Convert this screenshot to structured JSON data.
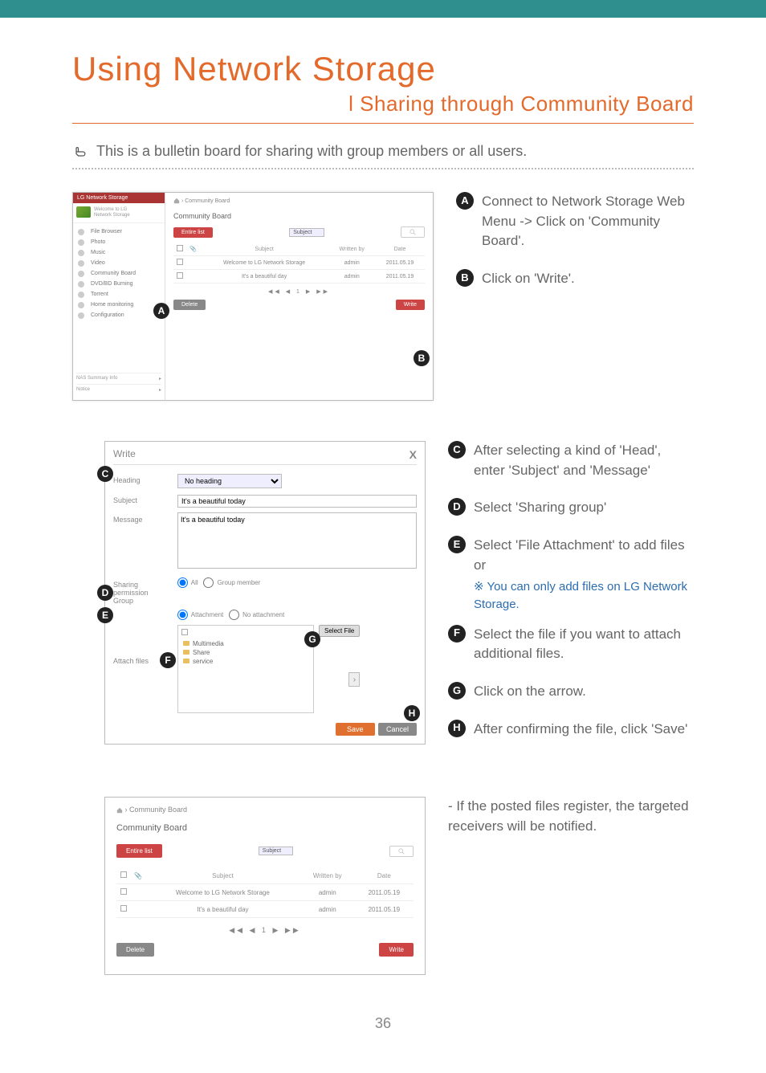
{
  "header": {
    "title": "Using Network Storage",
    "subtitle": "l Sharing through Community Board",
    "intro": "This is a bulletin board for sharing with group members or all users."
  },
  "page_number": "36",
  "shotA": {
    "brand": "LG Network Storage",
    "welcome_line1": "Welcome to LG",
    "welcome_line2": "Network Storage",
    "sidebar_items": [
      "File Browser",
      "Photo",
      "Music",
      "Video",
      "Community Board",
      "DVD/BD Burning",
      "Torrent",
      "Home monitoring",
      "Configuration"
    ],
    "footer1": "NAS Summary Info",
    "footer2": "Notice",
    "breadcrumb": "› Community Board",
    "panel_title": "Community Board",
    "entire_list": "Entire list",
    "subject_filter": "Subject",
    "columns": [
      "",
      "",
      "Subject",
      "Written by",
      "Date"
    ],
    "rows": [
      {
        "subject": "Welcome to LG Network Storage",
        "by": "admin",
        "date": "2011.05.19"
      },
      {
        "subject": "It's a beautiful day",
        "by": "admin",
        "date": "2011.05.19"
      }
    ],
    "pager": "◀◀ ◀ 1 ▶ ▶▶",
    "delete": "Delete",
    "write": "Write"
  },
  "calloutsA": {
    "A": "Connect to Network Storage Web Menu -> Click on 'Community Board'.",
    "B": "Click on 'Write'."
  },
  "shotB": {
    "dialog_title": "Write",
    "close": "X",
    "heading_label": "Heading",
    "heading_value": "No heading",
    "subject_label": "Subject",
    "subject_value": "It's a beautiful today",
    "message_label": "Message",
    "message_value": "It's a beautiful today",
    "sharing_label_1": "Sharing",
    "sharing_label_2": "permission",
    "sharing_label_3": "Group",
    "radio_all": "All",
    "radio_group": "Group member",
    "attach_radio_attach": "Attachment",
    "attach_radio_none": "No attachment",
    "attach_label": "Attach files",
    "tree_items": [
      "Multimedia",
      "Share",
      "service"
    ],
    "select_file": "Select File",
    "save": "Save",
    "cancel": "Cancel"
  },
  "calloutsB": {
    "C": "After selecting a kind of 'Head', enter 'Subject' and 'Message'",
    "D": "Select 'Sharing group'",
    "E": "Select 'File Attachment' to add files or",
    "E_note": "※ You can only add files on LG Network Storage.",
    "F": "Select the file if you want to attach additional files.",
    "G": "Click on the arrow.",
    "H": "After confirming the file, click 'Save'"
  },
  "shotC": {
    "breadcrumb": "› Community Board",
    "panel_title": "Community Board",
    "entire_list": "Entire list",
    "subject_filter": "Subject",
    "columns": [
      "",
      "",
      "Subject",
      "Written by",
      "Date"
    ],
    "rows": [
      {
        "subject": "Welcome to LG Network Storage",
        "by": "admin",
        "date": "2011.05.19"
      },
      {
        "subject": "It's a beautiful day",
        "by": "admin",
        "date": "2011.05.19"
      }
    ],
    "pager": "◀◀ ◀ 1 ▶ ▶▶",
    "delete": "Delete",
    "write": "Write"
  },
  "calloutsC": {
    "text": "- If the posted files register, the targeted receivers will be notified."
  }
}
